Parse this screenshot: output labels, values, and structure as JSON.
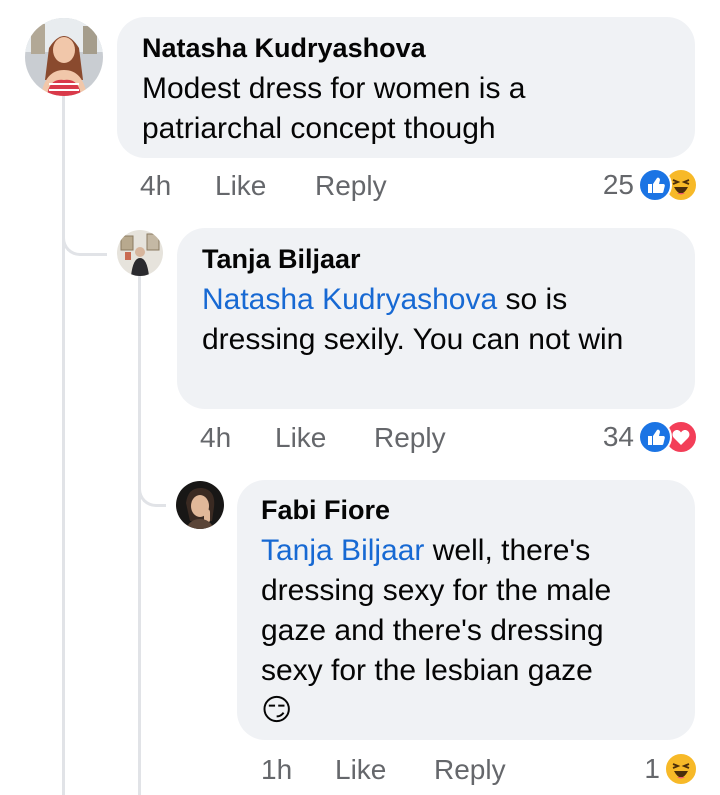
{
  "comments": [
    {
      "author": "Natasha Kudryashova",
      "mention": "",
      "text": "Modest dress for women is a patriarchal concept though",
      "emoji": "",
      "time": "4h",
      "like_label": "Like",
      "reply_label": "Reply",
      "reaction_count": "25",
      "reactions": [
        "like-icon",
        "haha-icon"
      ]
    },
    {
      "author": "Tanja Biljaar",
      "mention": "Natasha Kudryashova",
      "text": "so is dressing sexily. You can not win",
      "emoji": "",
      "time": "4h",
      "like_label": "Like",
      "reply_label": "Reply",
      "reaction_count": "34",
      "reactions": [
        "like-icon",
        "love-icon"
      ]
    },
    {
      "author": "Fabi Fiore",
      "mention": "Tanja Biljaar",
      "text": "well, there's dressing sexy for the male gaze and there's dressing sexy for the lesbian gaze",
      "emoji": "😏",
      "time": "1h",
      "like_label": "Like",
      "reply_label": "Reply",
      "reaction_count": "1",
      "reactions": [
        "haha-icon"
      ]
    }
  ],
  "colors": {
    "bubble": "#f0f2f5",
    "mention": "#1769d3",
    "meta": "#65676b",
    "like": "#1b74e4",
    "love": "#f33e58",
    "haha": "#f7b928",
    "thread_line": "#e1e3e7"
  }
}
